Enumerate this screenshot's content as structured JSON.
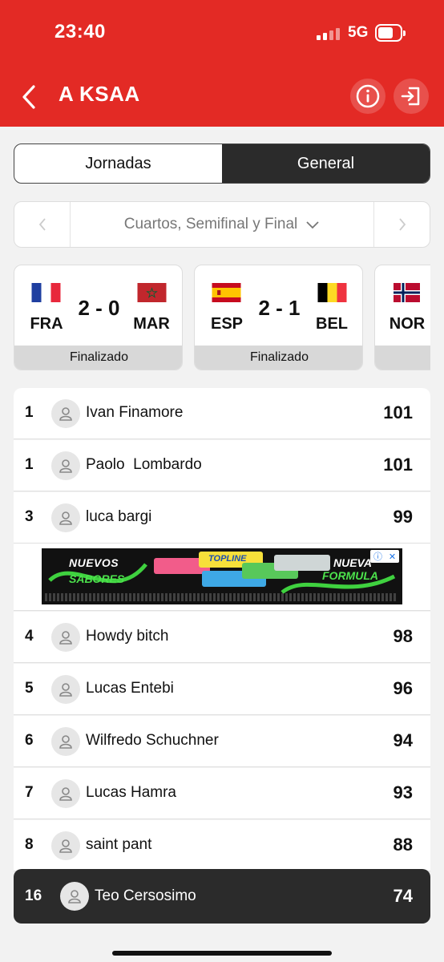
{
  "status_bar": {
    "time": "23:40",
    "network": "5G"
  },
  "header": {
    "title": "A KSAA"
  },
  "tabs": [
    {
      "label": "Jornadas",
      "active": false
    },
    {
      "label": "General",
      "active": true
    }
  ],
  "phase_selector": {
    "label": "Cuartos, Semifinal y Final"
  },
  "matches": [
    {
      "home": "FRA",
      "away": "MAR",
      "score": "2 - 0",
      "status": "Finalizado"
    },
    {
      "home": "ESP",
      "away": "BEL",
      "score": "2 - 1",
      "status": "Finalizado"
    },
    {
      "home": "NOR",
      "away": "",
      "score": "",
      "status": ""
    }
  ],
  "ranking": [
    {
      "position": "1",
      "name": "Ivan Finamore",
      "points": "101"
    },
    {
      "position": "1",
      "name": "Paolo  Lombardo",
      "points": "101"
    },
    {
      "position": "3",
      "name": "luca bargi",
      "points": "99"
    },
    {
      "position": "4",
      "name": "Howdy bitch",
      "points": "98"
    },
    {
      "position": "5",
      "name": "Lucas Entebi",
      "points": "96"
    },
    {
      "position": "6",
      "name": "Wilfredo Schuchner",
      "points": "94"
    },
    {
      "position": "7",
      "name": "Lucas Hamra",
      "points": "93"
    },
    {
      "position": "8",
      "name": "saint pant",
      "points": "88"
    }
  ],
  "current_user": {
    "position": "16",
    "name": "Teo Cersosimo",
    "points": "74"
  },
  "ad": {
    "headline_left_1": "NUEVOS",
    "headline_left_2": "SABORES",
    "headline_right_1": "NUEVA",
    "headline_right_2": "FORMULA",
    "brand": "TOPLINE"
  },
  "colors": {
    "brand_red": "#e32a25",
    "dark": "#2b2b2b"
  }
}
